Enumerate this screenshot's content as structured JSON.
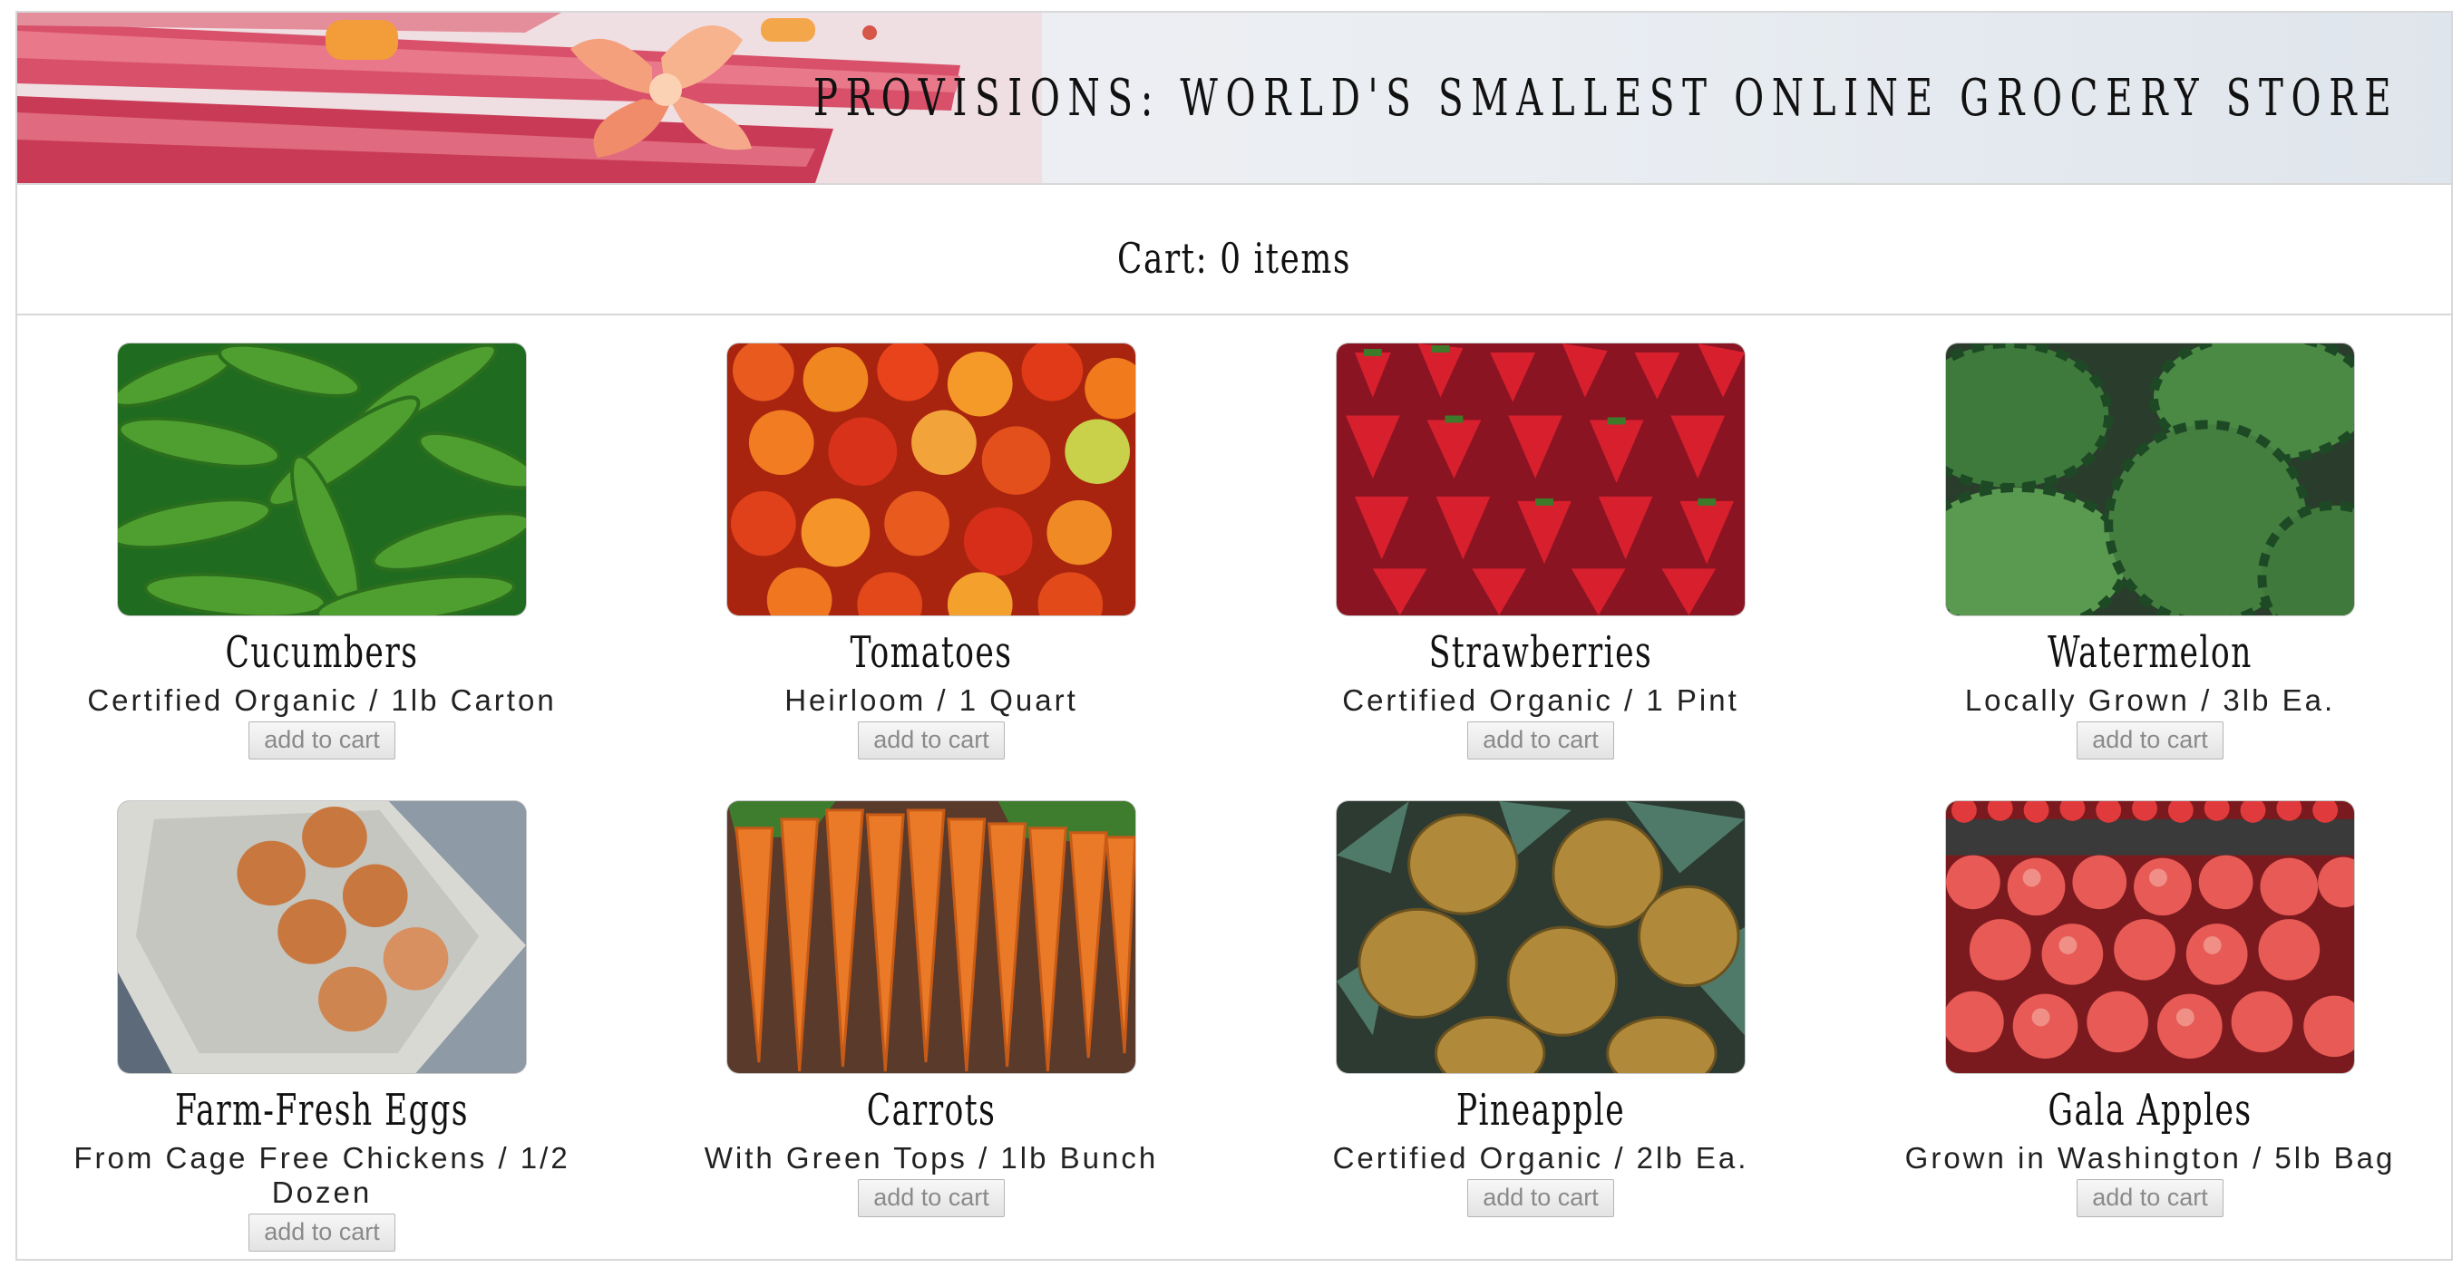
{
  "header": {
    "title": "PROVISIONS: WORLD'S SMALLEST ONLINE GROCERY STORE",
    "banner_image": "rhubarb-and-flower-photo"
  },
  "cart": {
    "label": "Cart: 0 items"
  },
  "products": [
    {
      "name": "Cucumbers",
      "description": "Certified Organic / 1lb Carton",
      "button": "add to cart",
      "image": "cucumbers-photo"
    },
    {
      "name": "Tomatoes",
      "description": "Heirloom / 1 Quart",
      "button": "add to cart",
      "image": "tomatoes-photo"
    },
    {
      "name": "Strawberries",
      "description": "Certified Organic / 1 Pint",
      "button": "add to cart",
      "image": "strawberries-photo"
    },
    {
      "name": "Watermelon",
      "description": "Locally Grown / 3lb Ea.",
      "button": "add to cart",
      "image": "watermelon-photo"
    },
    {
      "name": "Farm-Fresh Eggs",
      "description": "From Cage Free Chickens / 1/2 Dozen",
      "button": "add to cart",
      "image": "eggs-photo"
    },
    {
      "name": "Carrots",
      "description": "With Green Tops / 1lb Bunch",
      "button": "add to cart",
      "image": "carrots-photo"
    },
    {
      "name": "Pineapple",
      "description": "Certified Organic / 2lb Ea.",
      "button": "add to cart",
      "image": "pineapple-photo"
    },
    {
      "name": "Gala Apples",
      "description": "Grown in Washington / 5lb Bag",
      "button": "add to cart",
      "image": "apples-photo"
    }
  ],
  "colors": {
    "border": "#d8d8d8",
    "text": "#111111",
    "button_text": "#8a8a8a"
  }
}
